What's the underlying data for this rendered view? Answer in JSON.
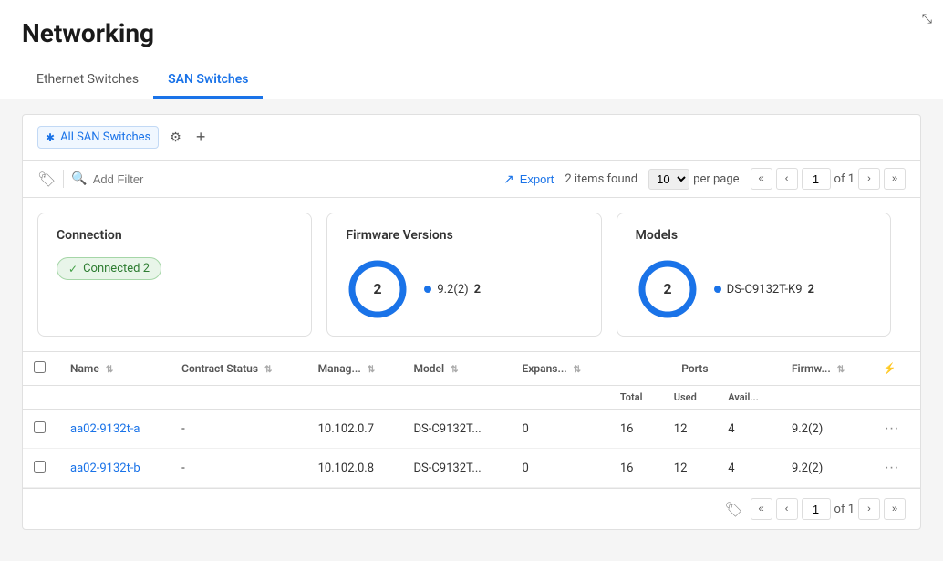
{
  "page": {
    "title": "Networking"
  },
  "tabs": [
    {
      "id": "ethernet",
      "label": "Ethernet Switches",
      "active": false
    },
    {
      "id": "san",
      "label": "SAN Switches",
      "active": true
    }
  ],
  "filter_tab": {
    "icon": "✱",
    "label": "All SAN Switches"
  },
  "toolbar": {
    "search_placeholder": "Add Filter",
    "export_label": "Export",
    "items_found": "2 items found",
    "per_page": "10",
    "per_page_label": "per page",
    "current_page": "1",
    "total_pages": "of 1"
  },
  "summary": {
    "connection_card": {
      "title": "Connection",
      "badge_label": "Connected 2"
    },
    "firmware_card": {
      "title": "Firmware Versions",
      "donut_value": "2",
      "legend": [
        {
          "label": "9.2(2)",
          "value": "2"
        }
      ]
    },
    "models_card": {
      "title": "Models",
      "donut_value": "2",
      "legend": [
        {
          "label": "DS-C9132T-K9",
          "value": "2"
        }
      ]
    }
  },
  "table": {
    "columns": [
      {
        "id": "name",
        "label": "Name",
        "sortable": true
      },
      {
        "id": "contract_status",
        "label": "Contract Status",
        "sortable": true
      },
      {
        "id": "manage",
        "label": "Manag...",
        "sortable": true
      },
      {
        "id": "model",
        "label": "Model",
        "sortable": true
      },
      {
        "id": "expansion",
        "label": "Expans...",
        "sortable": true
      },
      {
        "id": "ports_total",
        "label": "Total",
        "sortable": false
      },
      {
        "id": "ports_used",
        "label": "Used",
        "sortable": false
      },
      {
        "id": "ports_avail",
        "label": "Avail...",
        "sortable": false
      },
      {
        "id": "firmware",
        "label": "Firmw...",
        "sortable": true
      }
    ],
    "ports_header": "Ports",
    "rows": [
      {
        "name": "aa02-9132t-a",
        "contract_status": "-",
        "manage": "10.102.0.7",
        "model": "DS-C9132T...",
        "expansion": "0",
        "ports_total": "16",
        "ports_used": "12",
        "ports_avail": "4",
        "firmware": "9.2(2)"
      },
      {
        "name": "aa02-9132t-b",
        "contract_status": "-",
        "manage": "10.102.0.8",
        "model": "DS-C9132T...",
        "expansion": "0",
        "ports_total": "16",
        "ports_used": "12",
        "ports_avail": "4",
        "firmware": "9.2(2)"
      }
    ]
  },
  "pagination_footer": {
    "current_page": "1",
    "total_pages": "of 1"
  }
}
